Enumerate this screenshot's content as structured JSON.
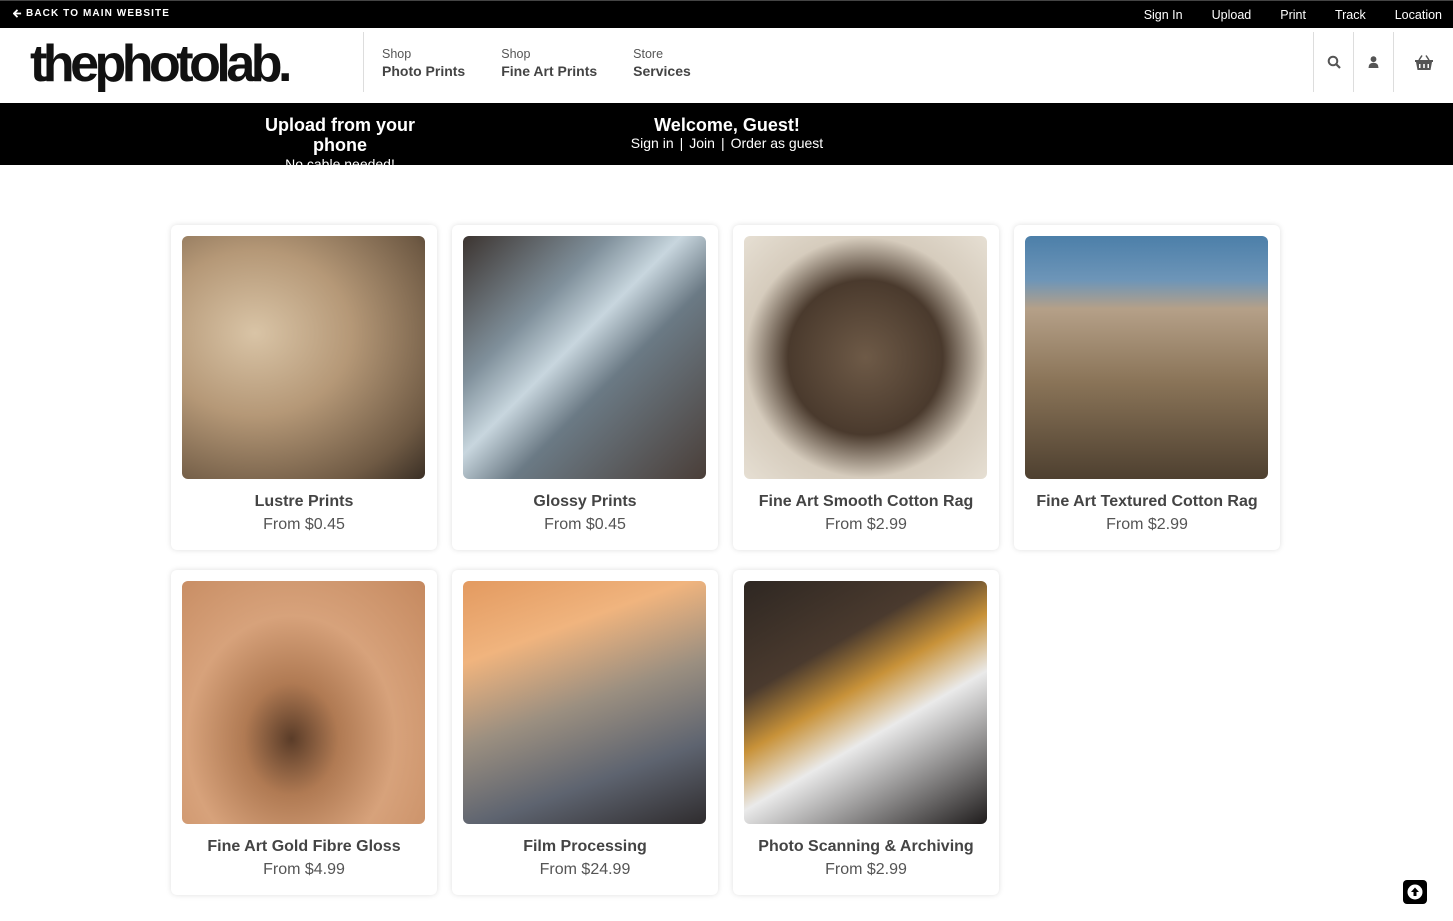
{
  "topbar": {
    "back_label": "BACK TO MAIN WEBSITE",
    "links": [
      "Sign In",
      "Upload",
      "Print",
      "Track",
      "Location"
    ]
  },
  "header": {
    "logo": "thephotolab.",
    "nav": [
      {
        "small": "Shop",
        "big": "Photo Prints"
      },
      {
        "small": "Shop",
        "big": "Fine Art Prints"
      },
      {
        "small": "Store",
        "big": "Services"
      }
    ],
    "icons": [
      "search-icon",
      "user-icon",
      "basket-icon"
    ]
  },
  "banner": {
    "upload_title": "Upload from your phone",
    "upload_sub": "No cable needed!",
    "welcome_title": "Welcome, Guest!",
    "links": [
      "Sign in",
      "Join",
      "Order as guest"
    ]
  },
  "products": [
    {
      "title": "Lustre Prints",
      "price": "From $0.45"
    },
    {
      "title": "Glossy Prints",
      "price": "From $0.45"
    },
    {
      "title": "Fine Art Smooth Cotton Rag",
      "price": "From $2.99"
    },
    {
      "title": "Fine Art Textured Cotton Rag",
      "price": "From $2.99"
    },
    {
      "title": "Fine Art Gold Fibre Gloss",
      "price": "From $4.99"
    },
    {
      "title": "Film Processing",
      "price": "From $24.99"
    },
    {
      "title": "Photo Scanning & Archiving",
      "price": "From $2.99"
    }
  ],
  "colors": {
    "topbar": "#000000",
    "banner": "#000000",
    "text": "#444444"
  }
}
